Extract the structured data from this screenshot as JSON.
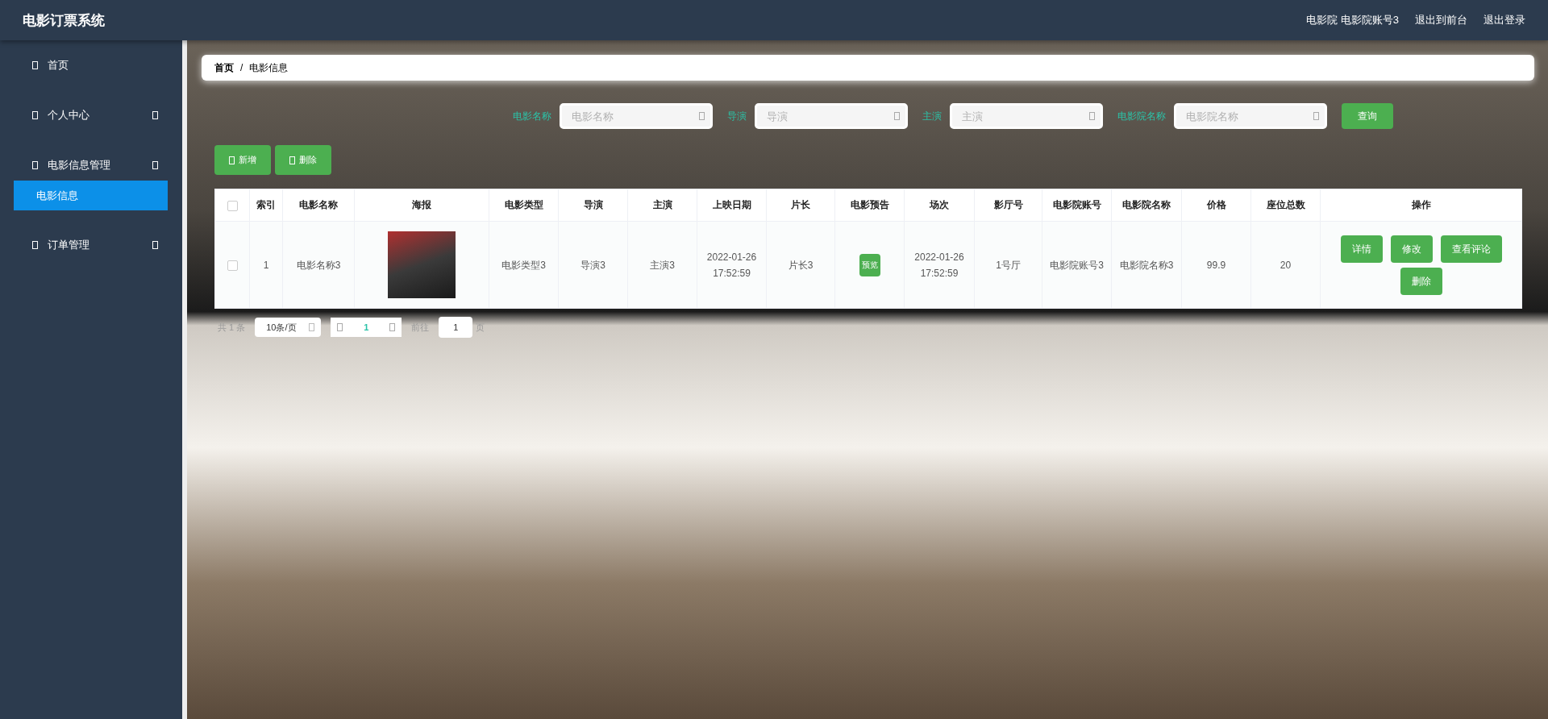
{
  "header": {
    "title": "电影订票系统",
    "user": "电影院 电影院账号3",
    "links": [
      "退出到前台",
      "退出登录"
    ]
  },
  "sidebar": {
    "items": [
      {
        "label": "首页",
        "kind": "link"
      },
      {
        "label": "个人中心",
        "kind": "submenu"
      },
      {
        "label": "电影信息管理",
        "kind": "submenu",
        "children": [
          {
            "label": "电影信息",
            "selected": true
          }
        ]
      },
      {
        "label": "订单管理",
        "kind": "submenu"
      }
    ]
  },
  "breadcrumb": [
    "首页",
    "电影信息"
  ],
  "breadcrumb_separator": "/",
  "search": {
    "fields": [
      {
        "label": "电影名称",
        "placeholder": "电影名称"
      },
      {
        "label": "导演",
        "placeholder": "导演"
      },
      {
        "label": "主演",
        "placeholder": "主演"
      },
      {
        "label": "电影院名称",
        "placeholder": "电影院名称"
      }
    ],
    "button": "查询"
  },
  "actions": [
    "新增",
    "删除"
  ],
  "table": {
    "select_all_checked": false,
    "columns": [
      "索引",
      "电影名称",
      "海报",
      "电影类型",
      "导演",
      "主演",
      "上映日期",
      "片长",
      "电影预告",
      "场次",
      "影厅号",
      "电影院账号",
      "电影院名称",
      "价格",
      "座位总数",
      "操作"
    ],
    "rows": [
      {
        "checked": false,
        "index": "1",
        "name": "电影名称3",
        "type": "电影类型3",
        "director": "导演3",
        "actor": "主演3",
        "release": "2022-01-26 17:52:59",
        "length": "片长3",
        "trailer": "预览",
        "session": "2022-01-26 17:52:59",
        "hall": "1号厅",
        "account": "电影院账号3",
        "cinema": "电影院名称3",
        "price": "99.9",
        "seats": "20",
        "operations": [
          "详情",
          "修改",
          "查看评论",
          "删除"
        ]
      }
    ]
  },
  "pagination": {
    "total": "共 1 条",
    "page_size": "10条/页",
    "current_page": "1",
    "goto_label": "前往",
    "goto_value": "1",
    "page_unit": "页"
  }
}
